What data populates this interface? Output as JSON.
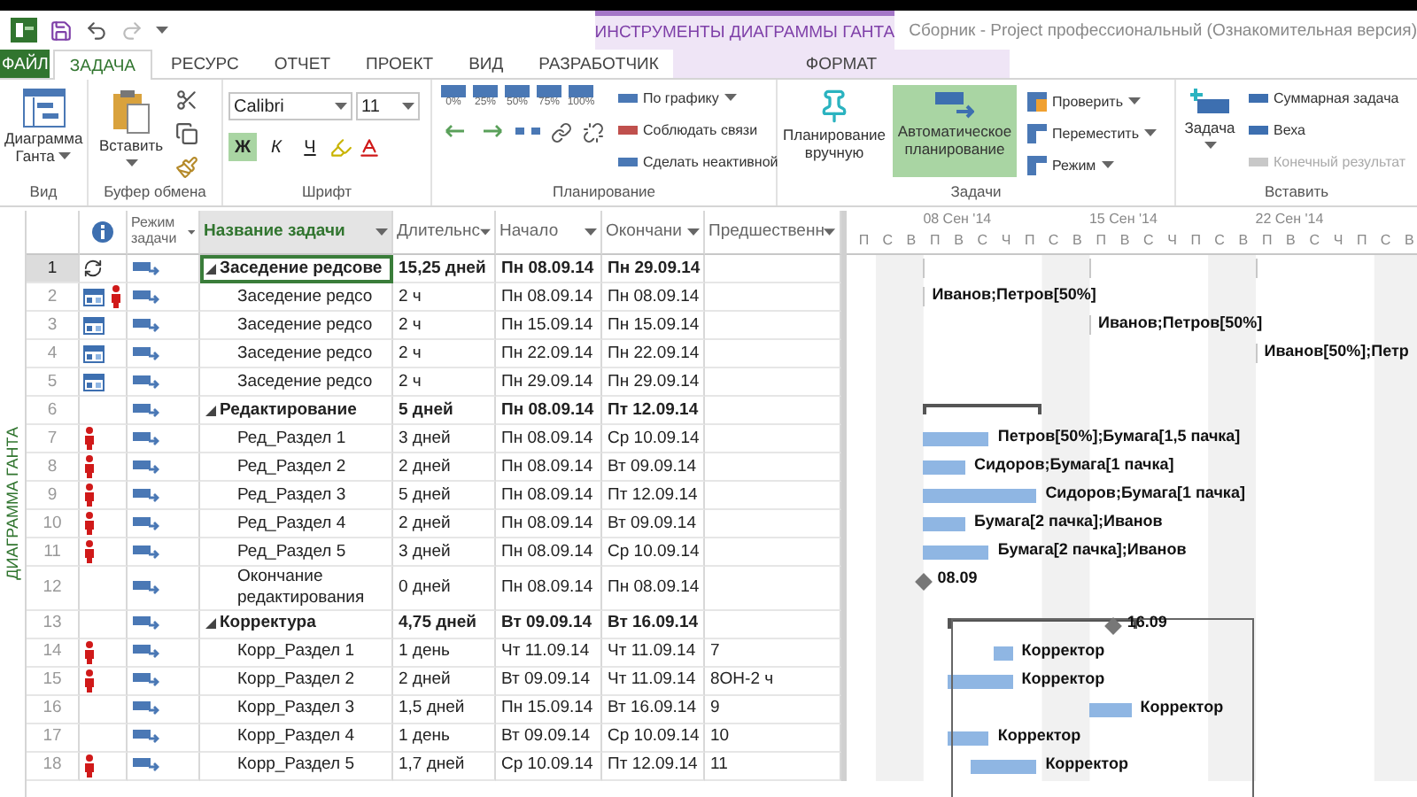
{
  "window": {
    "title": "Сборник - Project профессиональный (Ознакомительная версия)",
    "contextual_group": "ИНСТРУМЕНТЫ ДИАГРАММЫ ГАНТА"
  },
  "tabs": [
    {
      "label": "ФАЙЛ",
      "kind": "file",
      "selected": false
    },
    {
      "label": "ЗАДАЧА",
      "kind": "normal",
      "selected": true
    },
    {
      "label": "РЕСУРС",
      "kind": "normal",
      "selected": false
    },
    {
      "label": "ОТЧЕТ",
      "kind": "normal",
      "selected": false
    },
    {
      "label": "ПРОЕКТ",
      "kind": "normal",
      "selected": false
    },
    {
      "label": "ВИД",
      "kind": "normal",
      "selected": false
    },
    {
      "label": "РАЗРАБОТЧИК",
      "kind": "normal",
      "selected": false
    },
    {
      "label": "ФОРМАТ",
      "kind": "contextual",
      "selected": false
    }
  ],
  "ribbon": {
    "view": {
      "label": "Вид",
      "button": "Диаграмма Ганта"
    },
    "clipboard": {
      "label": "Буфер обмена",
      "paste": "Вставить"
    },
    "font": {
      "label": "Шрифт",
      "font_name": "Calibri",
      "font_size": "11",
      "bold": {
        "label": "Ж",
        "on": true
      },
      "italic": {
        "label": "К",
        "on": false
      },
      "underline": {
        "label": "Ч",
        "on": false
      }
    },
    "schedule": {
      "label": "Планирование",
      "progress": [
        "0%",
        "25%",
        "50%",
        "75%",
        "100%"
      ],
      "commands": [
        "По графику",
        "Соблюдать связи",
        "Сделать неактивной"
      ]
    },
    "tasks": {
      "label": "Задачи",
      "modes": [
        {
          "label": "Планирование вручную",
          "selected": false
        },
        {
          "label": "Автоматическое планирование",
          "selected": true
        }
      ],
      "commands": [
        "Проверить",
        "Переместить",
        "Режим"
      ]
    },
    "insert": {
      "label": "Вставить",
      "task": "Задача",
      "commands": [
        {
          "label": "Суммарная задача",
          "disabled": false
        },
        {
          "label": "Веха",
          "disabled": false
        },
        {
          "label": "Конечный результат",
          "disabled": true
        }
      ]
    }
  },
  "view_label": "ДИАГРАММА ГАНТА",
  "table": {
    "columns": [
      {
        "label": "Режим задачи",
        "selected": false
      },
      {
        "label": "Название задачи",
        "selected": true
      },
      {
        "label": "Длительнс",
        "selected": false
      },
      {
        "label": "Начало",
        "selected": false
      },
      {
        "label": "Окончани",
        "selected": false
      },
      {
        "label": "Предшественн",
        "selected": false
      }
    ],
    "rows": [
      {
        "id": "1",
        "name": "Заседение редсове",
        "duration": "15,25 дней",
        "start": "Пн 08.09.14",
        "finish": "Пн 29.09.14",
        "kind": "recurring_summary",
        "assigned": false,
        "selected": true,
        "expanded": true,
        "children": [
          {
            "id": "2",
            "name": "Заседение редсо",
            "duration": "2 ч",
            "start": "Пн 08.09.14",
            "finish": "Пн 08.09.14",
            "kind": "recurring",
            "assigned": true,
            "selected": false,
            "gantt_label": "Иванов;Петров[50%]"
          },
          {
            "id": "3",
            "name": "Заседение редсо",
            "duration": "2 ч",
            "start": "Пн 15.09.14",
            "finish": "Пн 15.09.14",
            "kind": "recurring",
            "assigned": false,
            "selected": false,
            "gantt_label": "Иванов;Петров[50%]"
          },
          {
            "id": "4",
            "name": "Заседение редсо",
            "duration": "2 ч",
            "start": "Пн 22.09.14",
            "finish": "Пн 22.09.14",
            "kind": "recurring",
            "assigned": false,
            "selected": false,
            "gantt_label": "Иванов[50%];Петр"
          },
          {
            "id": "5",
            "name": "Заседение редсо",
            "duration": "2 ч",
            "start": "Пн 29.09.14",
            "finish": "Пн 29.09.14",
            "kind": "recurring",
            "assigned": false,
            "selected": false
          }
        ]
      },
      {
        "id": "6",
        "name": "Редактирование",
        "duration": "5 дней",
        "start": "Пн 08.09.14",
        "finish": "Пт 12.09.14",
        "kind": "summary",
        "assigned": false,
        "selected": false,
        "expanded": true,
        "children": [
          {
            "id": "7",
            "name": "Ред_Раздел 1",
            "duration": "3 дней",
            "start": "Пн 08.09.14",
            "finish": "Ср 10.09.14",
            "kind": "task",
            "assigned": true,
            "selected": false,
            "gantt_label": "Петров[50%];Бумага[1,5 пачка]"
          },
          {
            "id": "8",
            "name": "Ред_Раздел 2",
            "duration": "2 дней",
            "start": "Пн 08.09.14",
            "finish": "Вт 09.09.14",
            "kind": "task",
            "assigned": true,
            "selected": false,
            "gantt_label": "Сидоров;Бумага[1 пачка]"
          },
          {
            "id": "9",
            "name": "Ред_Раздел 3",
            "duration": "5 дней",
            "start": "Пн 08.09.14",
            "finish": "Пт 12.09.14",
            "kind": "task",
            "assigned": true,
            "selected": false,
            "gantt_label": "Сидоров;Бумага[1 пачка]"
          },
          {
            "id": "10",
            "name": "Ред_Раздел 4",
            "duration": "2 дней",
            "start": "Пн 08.09.14",
            "finish": "Вт 09.09.14",
            "kind": "task",
            "assigned": true,
            "selected": false,
            "gantt_label": "Бумага[2 пачка];Иванов"
          },
          {
            "id": "11",
            "name": "Ред_Раздел 5",
            "duration": "3 дней",
            "start": "Пн 08.09.14",
            "finish": "Ср 10.09.14",
            "kind": "task",
            "assigned": true,
            "selected": false,
            "gantt_label": "Бумага[2 пачка];Иванов"
          },
          {
            "id": "12",
            "name": "Окончание редактирования",
            "duration": "0 дней",
            "start": "Пн 08.09.14",
            "finish": "Пн 08.09.14",
            "kind": "milestone",
            "assigned": false,
            "selected": false,
            "gantt_label": "08.09"
          }
        ]
      },
      {
        "id": "13",
        "name": "Корректура",
        "duration": "4,75 дней",
        "start": "Вт 09.09.14",
        "finish": "Вт 16.09.14",
        "kind": "summary",
        "assigned": false,
        "selected": false,
        "expanded": true,
        "gantt_label": "16.09",
        "children": [
          {
            "id": "14",
            "name": "Корр_Раздел 1",
            "duration": "1 день",
            "start": "Чт 11.09.14",
            "finish": "Чт 11.09.14",
            "predecessors": "7",
            "kind": "task",
            "assigned": true,
            "selected": false,
            "gantt_label": "Корректор"
          },
          {
            "id": "15",
            "name": "Корр_Раздел 2",
            "duration": "2 дней",
            "start": "Вт 09.09.14",
            "finish": "Чт 11.09.14",
            "predecessors": "8ОН-2 ч",
            "kind": "task",
            "assigned": true,
            "selected": false,
            "gantt_label": "Корректор"
          },
          {
            "id": "16",
            "name": "Корр_Раздел 3",
            "duration": "1,5 дней",
            "start": "Пн 15.09.14",
            "finish": "Вт 16.09.14",
            "predecessors": "9",
            "kind": "task",
            "assigned": false,
            "selected": false,
            "gantt_label": "Корректор"
          },
          {
            "id": "17",
            "name": "Корр_Раздел 4",
            "duration": "1 день",
            "start": "Вт 09.09.14",
            "finish": "Ср 10.09.14",
            "predecessors": "10",
            "kind": "task",
            "assigned": false,
            "selected": false,
            "gantt_label": "Корректор"
          },
          {
            "id": "18",
            "name": "Корр_Раздел 5",
            "duration": "1,7 дней",
            "start": "Ср 10.09.14",
            "finish": "Пт 12.09.14",
            "predecessors": "11",
            "kind": "task",
            "assigned": true,
            "selected": false,
            "gantt_label": "Корректор"
          }
        ]
      }
    ]
  },
  "timescale": {
    "weeks": [
      "08 Сен '14",
      "15 Сен '14",
      "22 Сен '14"
    ],
    "days": [
      "П",
      "С",
      "В",
      "П",
      "В",
      "С",
      "Ч",
      "П",
      "С",
      "В",
      "П",
      "В",
      "С",
      "Ч",
      "П",
      "С",
      "В",
      "П",
      "В",
      "С",
      "Ч",
      "П",
      "С",
      "В"
    ]
  }
}
